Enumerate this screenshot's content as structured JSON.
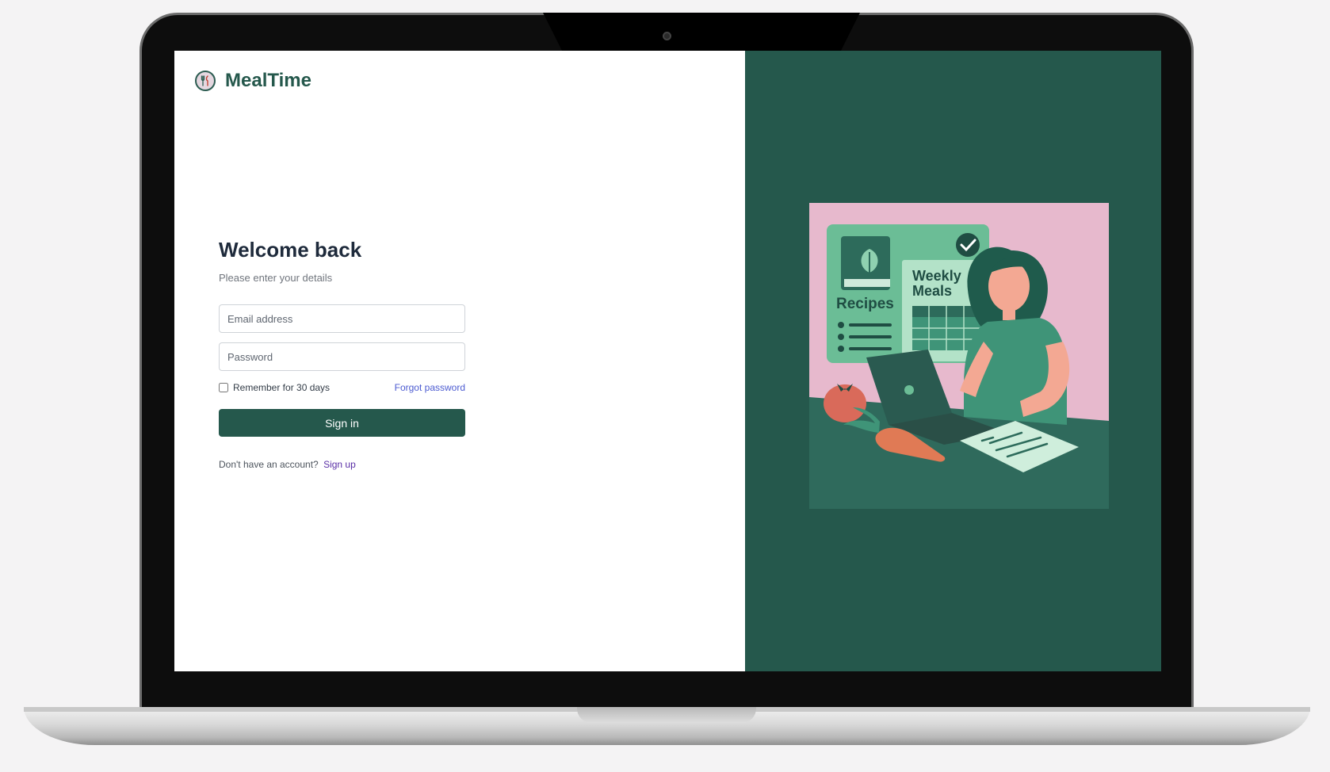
{
  "brand": {
    "name": "MealTime",
    "logo_icon": "fork-knife-icon"
  },
  "login": {
    "title": "Welcome back",
    "subtitle": "Please enter your details",
    "email_placeholder": "Email address",
    "password_placeholder": "Password",
    "remember_label": "Remember for 30 days",
    "forgot_label": "Forgot password",
    "signin_label": "Sign in",
    "no_account_text": "Don't have an account?",
    "signup_label": "Sign up"
  },
  "illustration": {
    "recipes_label": "Recipes",
    "weekly_label_line1": "Weekly",
    "weekly_label_line2": "Meals"
  },
  "colors": {
    "brand": "#25584c",
    "panel": "#25584c",
    "accent_link": "#4c5bd1",
    "signup_link": "#5a2fa6",
    "illustration_bg": "#e7b9cd"
  }
}
